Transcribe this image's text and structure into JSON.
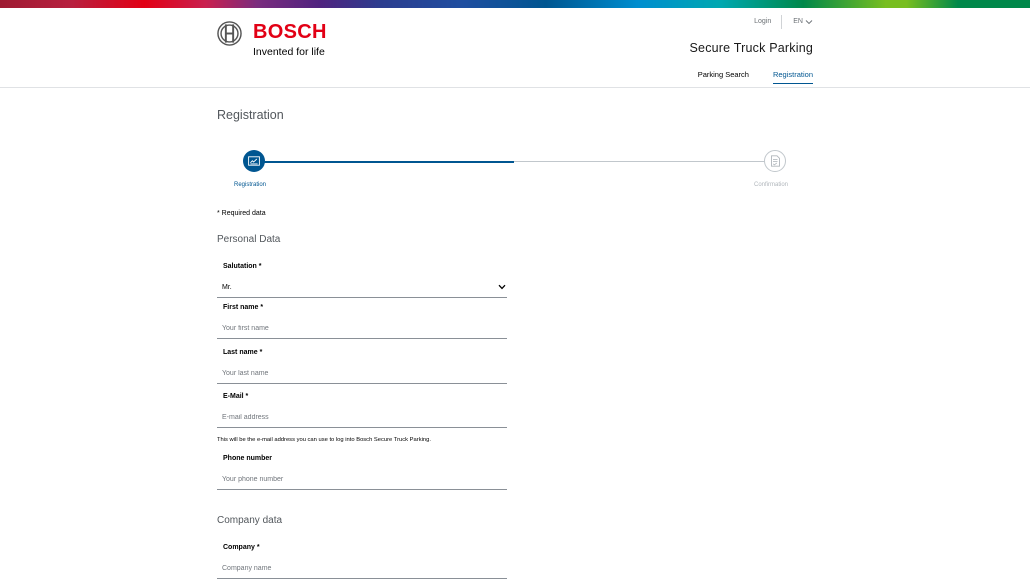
{
  "brand": {
    "name": "BOSCH",
    "claim": "Invented for life"
  },
  "topnav": {
    "login": "Login",
    "language": "EN"
  },
  "site_title": "Secure Truck Parking",
  "mainnav": [
    {
      "label": "Parking Search",
      "active": false
    },
    {
      "label": "Registration",
      "active": true
    }
  ],
  "page_title": "Registration",
  "progress": {
    "fraction_complete": 0.5,
    "steps": [
      {
        "label": "Registration",
        "icon": "id-card-icon",
        "active": true
      },
      {
        "label": "Confirmation",
        "icon": "document-check-icon",
        "active": false
      }
    ]
  },
  "required_note": "* Required data",
  "personal": {
    "title": "Personal Data",
    "salutation": {
      "label": "Salutation *",
      "value": "Mr."
    },
    "first_name": {
      "label": "First name *",
      "placeholder": "Your first name"
    },
    "last_name": {
      "label": "Last name *",
      "placeholder": "Your last name"
    },
    "email": {
      "label": "E-Mail *",
      "placeholder": "E-mail address",
      "hint": "This will be the e-mail address you can use to log into Bosch Secure Truck Parking."
    },
    "phone": {
      "label": "Phone number",
      "placeholder": "Your phone number"
    }
  },
  "company": {
    "title": "Company data",
    "company": {
      "label": "Company *",
      "placeholder": "Company name"
    }
  },
  "colors": {
    "brand_red": "#e20015",
    "accent_blue": "#005691",
    "line_gray": "#c1c7cc"
  }
}
